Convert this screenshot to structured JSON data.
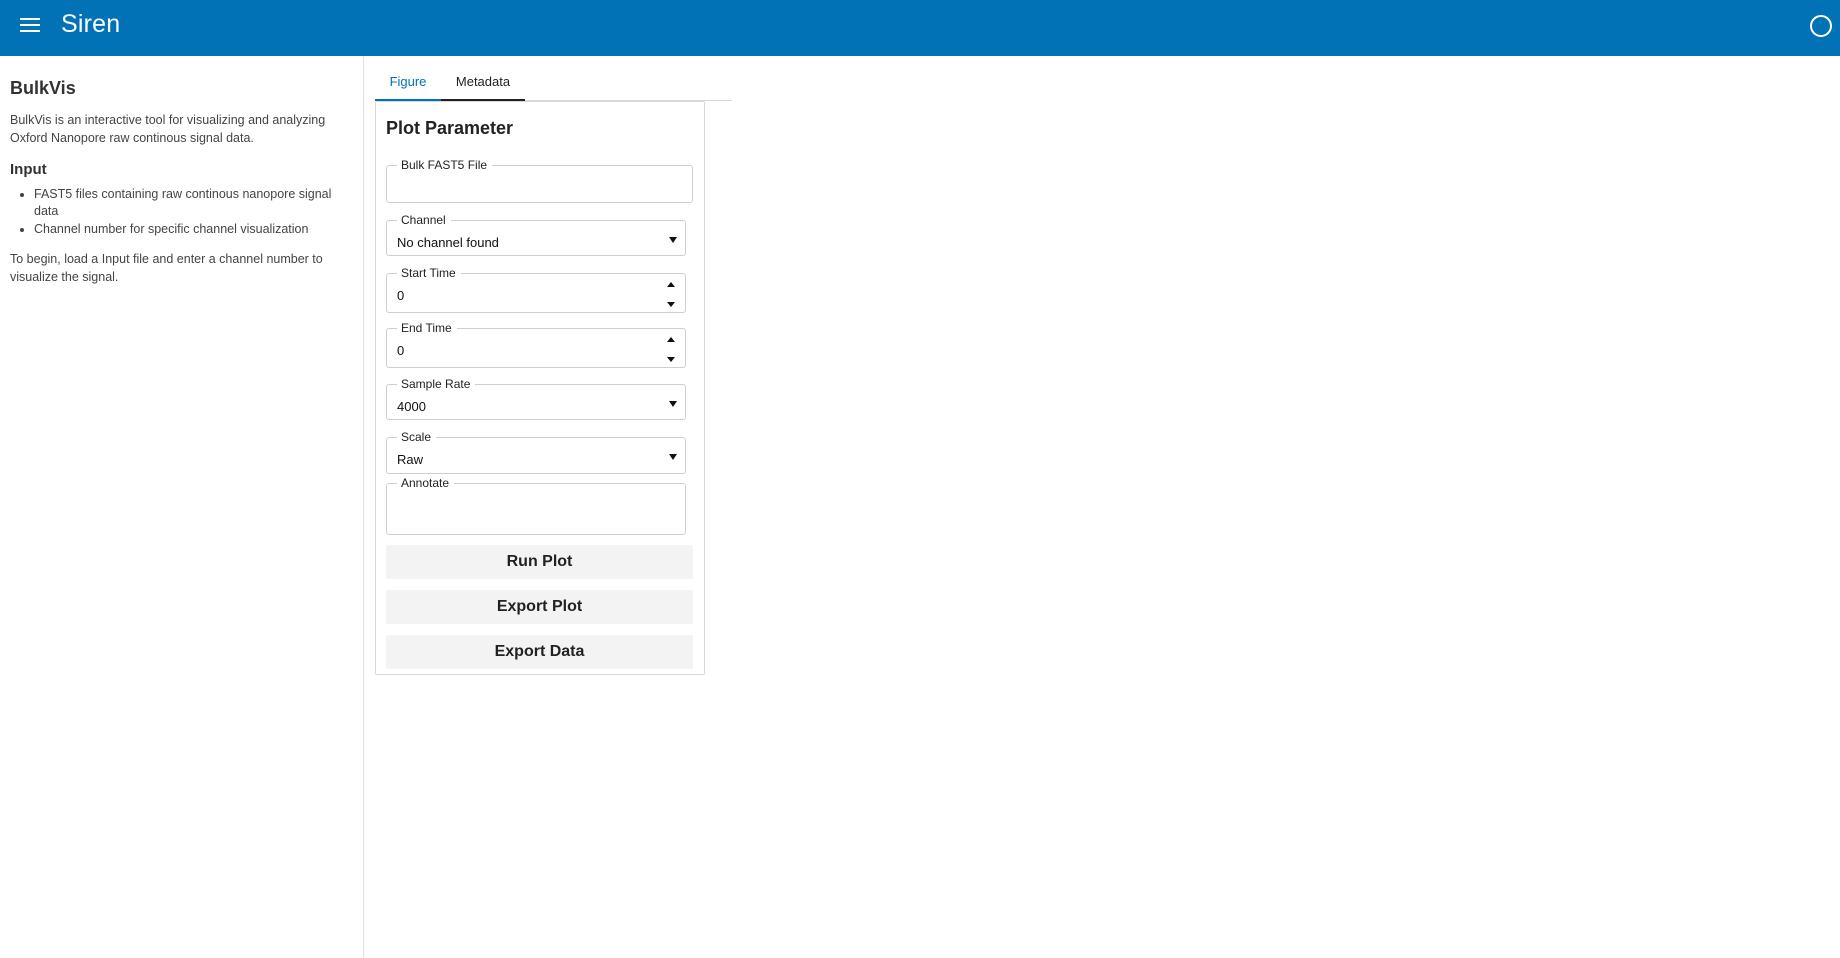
{
  "header": {
    "title": "Siren"
  },
  "sidebar": {
    "title": "BulkVis",
    "description": "BulkVis is an interactive tool for visualizing and analyzing Oxford Nanopore raw continous signal data.",
    "input_heading": "Input",
    "input_items": [
      "FAST5 files containing raw continous nanopore signal data",
      "Channel number for specific channel visualization"
    ],
    "instructions": "To begin, load a Input file and enter a channel number to visualize the signal."
  },
  "tabs": [
    {
      "label": "Figure",
      "active": true
    },
    {
      "label": "Metadata",
      "active": false
    }
  ],
  "panel": {
    "title": "Plot Parameter",
    "fields": {
      "bulk_file": {
        "label": "Bulk FAST5 File",
        "value": ""
      },
      "channel": {
        "label": "Channel",
        "value": "No channel found"
      },
      "start_time": {
        "label": "Start Time",
        "value": "0"
      },
      "end_time": {
        "label": "End Time",
        "value": "0"
      },
      "sample_rate": {
        "label": "Sample Rate",
        "value": "4000"
      },
      "scale": {
        "label": "Scale",
        "value": "Raw"
      },
      "annotate": {
        "label": "Annotate",
        "value": ""
      }
    },
    "buttons": {
      "run": "Run Plot",
      "export_plot": "Export Plot",
      "export_data": "Export Data"
    }
  },
  "colors": {
    "header": "#0072b5",
    "accent": "#0072b5"
  },
  "icons": {
    "menu": "hamburger-menu-icon",
    "status": "circle-status-icon"
  }
}
